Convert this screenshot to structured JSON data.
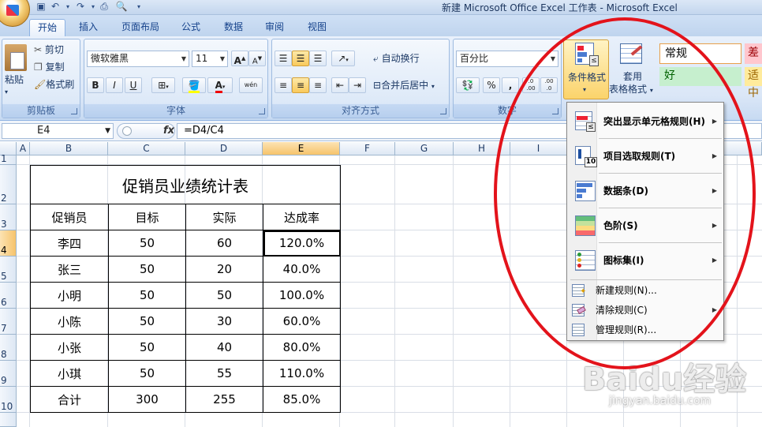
{
  "window": {
    "title": "新建 Microsoft Office Excel 工作表 - Microsoft Excel"
  },
  "tabs": [
    "开始",
    "插入",
    "页面布局",
    "公式",
    "数据",
    "审阅",
    "视图"
  ],
  "ribbon": {
    "clipboard": {
      "paste": "粘贴",
      "cut": "剪切",
      "copy": "复制",
      "format_painter": "格式刷",
      "label": "剪贴板"
    },
    "font": {
      "name": "微软雅黑",
      "size": "11",
      "bold": "B",
      "italic": "I",
      "underline": "U",
      "grow": "A",
      "shrink": "A",
      "color": "A",
      "phonetic": "wén",
      "label": "字体"
    },
    "alignment": {
      "wrap": "自动换行",
      "merge": "合并后居中",
      "label": "对齐方式"
    },
    "number": {
      "format": "百分比",
      "percent": "%",
      "comma": ",",
      "inc_decimal": ".0 .00",
      "dec_decimal": ".00 .0",
      "label": "数字"
    },
    "styles": {
      "conditional_format": "条件格式",
      "table_format_1": "套用",
      "table_format_2": "表格格式",
      "normal": "常规",
      "bad": "差",
      "good": "好",
      "neutral": "适中"
    }
  },
  "formula_bar": {
    "name_box": "E4",
    "fx": "fx",
    "formula": "=D4/C4"
  },
  "columns": [
    "A",
    "B",
    "C",
    "D",
    "E",
    "F",
    "G",
    "H",
    "I"
  ],
  "rows": [
    "1",
    "2",
    "3",
    "4",
    "5",
    "6",
    "7",
    "8",
    "9",
    "10"
  ],
  "table": {
    "title": "促销员业绩统计表",
    "headers": [
      "促销员",
      "目标",
      "实际",
      "达成率"
    ],
    "rows": [
      [
        "李四",
        "50",
        "60",
        "120.0%"
      ],
      [
        "张三",
        "50",
        "20",
        "40.0%"
      ],
      [
        "小明",
        "50",
        "50",
        "100.0%"
      ],
      [
        "小陈",
        "50",
        "30",
        "60.0%"
      ],
      [
        "小张",
        "50",
        "40",
        "80.0%"
      ],
      [
        "小琪",
        "50",
        "55",
        "110.0%"
      ],
      [
        "合计",
        "300",
        "255",
        "85.0%"
      ]
    ]
  },
  "menu": {
    "big_items": [
      {
        "label": "突出显示单元格规则(H)",
        "icon": "highlight-rules-icon"
      },
      {
        "label": "项目选取规则(T)",
        "icon": "top-bottom-rules-icon"
      },
      {
        "label": "数据条(D)",
        "icon": "data-bars-icon"
      },
      {
        "label": "色阶(S)",
        "icon": "color-scales-icon"
      },
      {
        "label": "图标集(I)",
        "icon": "icon-sets-icon"
      }
    ],
    "small_items": [
      {
        "label": "新建规则(N)...",
        "icon": "new-rule-icon"
      },
      {
        "label": "清除规则(C)",
        "icon": "clear-rules-icon"
      },
      {
        "label": "管理规则(R)...",
        "icon": "manage-rules-icon"
      }
    ]
  },
  "watermark": {
    "brand": "Baidu经验",
    "url": "jingyan.baidu.com"
  },
  "colors": {
    "annotation": "#e3131b",
    "selection": "#f6c36b",
    "ribbon": "#dbe7f7"
  }
}
